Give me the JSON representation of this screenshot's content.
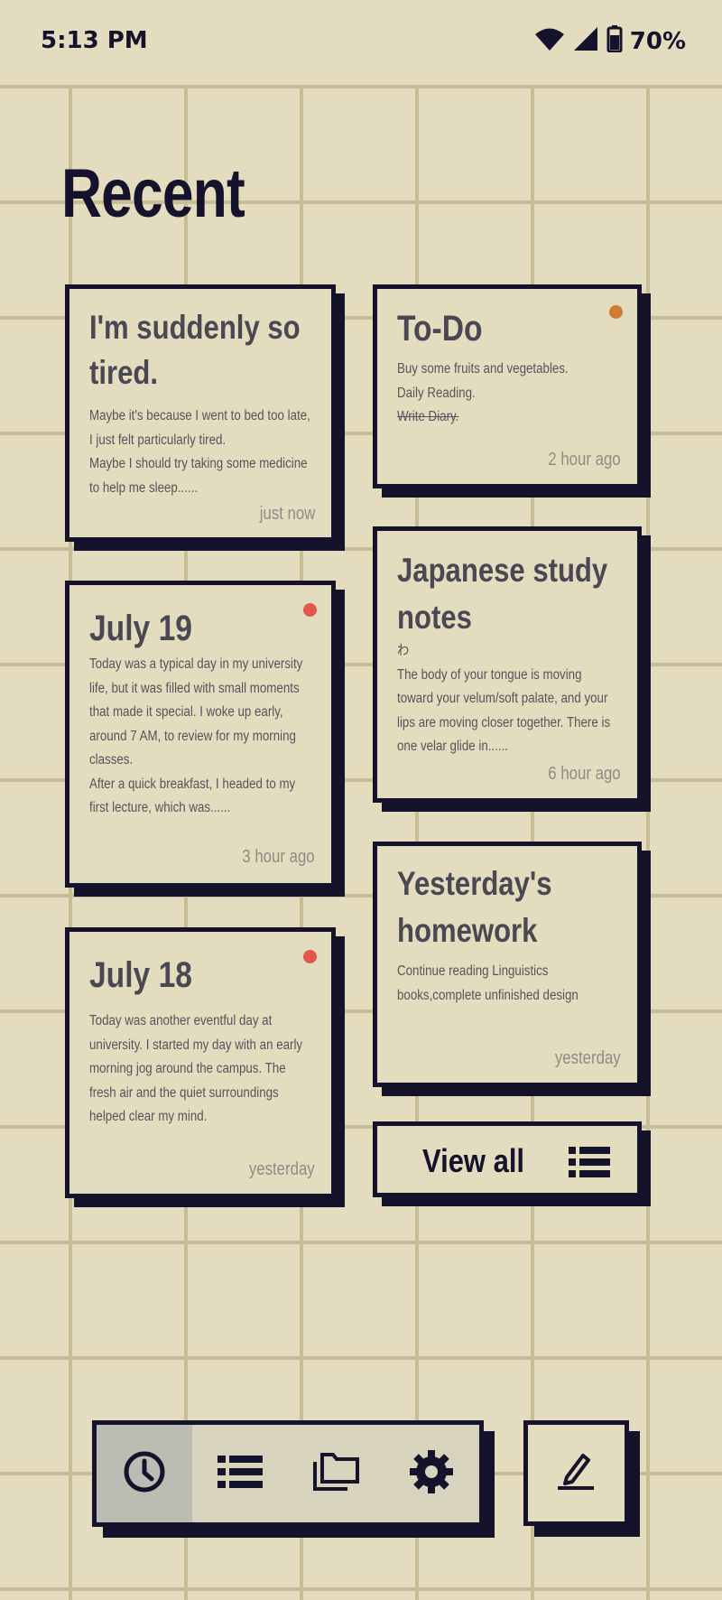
{
  "status_bar": {
    "time": "5:13 PM",
    "battery": "70%",
    "icons": [
      "wifi-icon",
      "signal-icon",
      "battery-icon"
    ]
  },
  "page": {
    "title": "Recent"
  },
  "notes": [
    {
      "title": "I'm suddenly so tired.",
      "body": [
        "Maybe it's because I went to bed too late,",
        "I just felt particularly tired.",
        "Maybe I should try taking some medicine",
        "to help me sleep......"
      ],
      "time": "just now"
    },
    {
      "title": "July 19",
      "body": [
        "Today was a typical day in my university",
        "life, but it was filled with small moments",
        "that made it special. I woke up early,",
        "around 7 AM, to review for my morning",
        "classes.",
        "After a quick breakfast, I headed to my",
        "first lecture, which was......"
      ],
      "time": "3 hour ago",
      "marker_color": "#e2574c"
    },
    {
      "title": "July 18",
      "body": [
        "Today was another eventful day at",
        "university. I started my day with an early",
        "morning jog around the campus. The",
        "fresh air and the quiet surroundings",
        "helped clear my mind."
      ],
      "time": "yesterday",
      "marker_color": "#e2574c"
    },
    {
      "title": "To-Do",
      "body": [
        "Buy some fruits and vegetables.",
        "Daily Reading.",
        "Write Diary."
      ],
      "completed_item": "Write Diary.",
      "time": "2 hour ago",
      "marker_color": "#cf7b34"
    },
    {
      "title_lines": [
        "Japanese study",
        "notes"
      ],
      "body": [
        "わ",
        "The body of your tongue is moving",
        "toward your velum/soft palate, and your",
        "lips are moving closer together. There is",
        "one velar glide in......"
      ],
      "time": "6 hour ago"
    },
    {
      "title_lines": [
        "Yesterday's",
        "homework"
      ],
      "body": [
        "Continue reading Linguistics",
        "books,complete unfinished design"
      ],
      "time": "yesterday"
    }
  ],
  "view_all": {
    "label": "View all",
    "icon": "list-icon"
  },
  "nav": {
    "items": [
      {
        "icon": "clock-icon",
        "active": true
      },
      {
        "icon": "list-icon",
        "active": false
      },
      {
        "icon": "folder-icon",
        "active": false
      },
      {
        "icon": "gear-icon",
        "active": false
      }
    ],
    "compose_icon": "edit-icon"
  },
  "colors": {
    "background": "#e3dcbe",
    "grid": "#c9bd95",
    "ink": "#15122b",
    "red_marker": "#e2574c",
    "orange_marker": "#cf7b34",
    "nav_active": "#bcbcb4"
  }
}
